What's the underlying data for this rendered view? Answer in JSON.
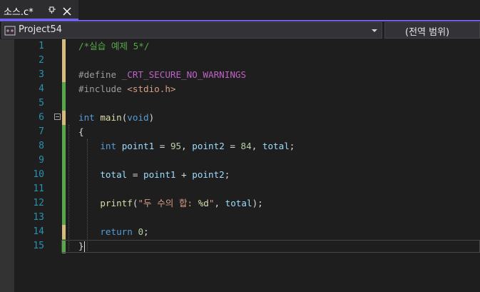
{
  "tab": {
    "title": "소스.c*",
    "pin_icon": "pin-icon",
    "close_icon": "close-icon"
  },
  "navbar": {
    "project": "Project54",
    "scope": "(전역 범위)"
  },
  "editor": {
    "line_numbers": [
      "1",
      "2",
      "3",
      "4",
      "5",
      "6",
      "7",
      "8",
      "9",
      "10",
      "11",
      "12",
      "13",
      "14",
      "15"
    ],
    "change_colors": {
      "saved": "#57a64a",
      "unsaved": "#d7ba7d"
    },
    "lines": [
      [
        {
          "t": "/*실습 예제 5*/",
          "c": "c-comment"
        }
      ],
      [],
      [
        {
          "t": "#define ",
          "c": "c-pre"
        },
        {
          "t": "_CRT_SECURE_NO_WARNINGS",
          "c": "c-macro"
        }
      ],
      [
        {
          "t": "#include ",
          "c": "c-pre"
        },
        {
          "t": "<stdio.h>",
          "c": "c-inc"
        }
      ],
      [],
      [
        {
          "t": "int",
          "c": "c-kw"
        },
        {
          "t": " ",
          "c": "c-punc"
        },
        {
          "t": "main",
          "c": "c-fn"
        },
        {
          "t": "(",
          "c": "c-punc"
        },
        {
          "t": "void",
          "c": "c-kw"
        },
        {
          "t": ")",
          "c": "c-punc"
        }
      ],
      [
        {
          "t": "{",
          "c": "c-punc"
        }
      ],
      [
        {
          "t": "    ",
          "c": "c-punc"
        },
        {
          "t": "int",
          "c": "c-kw"
        },
        {
          "t": " ",
          "c": "c-punc"
        },
        {
          "t": "point1",
          "c": "c-var"
        },
        {
          "t": " = ",
          "c": "c-punc"
        },
        {
          "t": "95",
          "c": "c-num"
        },
        {
          "t": ", ",
          "c": "c-punc"
        },
        {
          "t": "point2",
          "c": "c-var"
        },
        {
          "t": " = ",
          "c": "c-punc"
        },
        {
          "t": "84",
          "c": "c-num"
        },
        {
          "t": ", ",
          "c": "c-punc"
        },
        {
          "t": "total",
          "c": "c-var"
        },
        {
          "t": ";",
          "c": "c-punc"
        }
      ],
      [],
      [
        {
          "t": "    ",
          "c": "c-punc"
        },
        {
          "t": "total",
          "c": "c-var"
        },
        {
          "t": " = ",
          "c": "c-punc"
        },
        {
          "t": "point1",
          "c": "c-var"
        },
        {
          "t": " + ",
          "c": "c-punc"
        },
        {
          "t": "point2",
          "c": "c-var"
        },
        {
          "t": ";",
          "c": "c-punc"
        }
      ],
      [],
      [
        {
          "t": "    ",
          "c": "c-punc"
        },
        {
          "t": "printf",
          "c": "c-fn"
        },
        {
          "t": "(",
          "c": "c-punc"
        },
        {
          "t": "\"두 수의 합: ",
          "c": "c-str"
        },
        {
          "t": "%d",
          "c": "c-fmt"
        },
        {
          "t": "\"",
          "c": "c-str"
        },
        {
          "t": ", ",
          "c": "c-punc"
        },
        {
          "t": "total",
          "c": "c-var"
        },
        {
          "t": ");",
          "c": "c-punc"
        }
      ],
      [],
      [
        {
          "t": "    ",
          "c": "c-punc"
        },
        {
          "t": "return",
          "c": "c-kw"
        },
        {
          "t": " ",
          "c": "c-punc"
        },
        {
          "t": "0",
          "c": "c-num"
        },
        {
          "t": ";",
          "c": "c-punc"
        }
      ],
      [
        {
          "t": "}",
          "c": "c-punc"
        }
      ]
    ],
    "change_status": [
      "unsaved",
      "unsaved",
      "unsaved",
      "saved",
      "saved",
      "unsaved",
      "saved",
      "saved",
      "saved",
      "saved",
      "saved",
      "saved",
      "saved",
      "unsaved",
      "saved"
    ]
  }
}
